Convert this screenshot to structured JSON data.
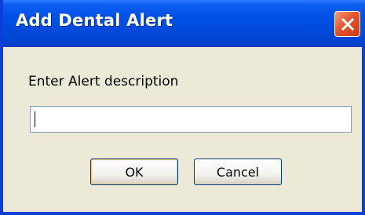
{
  "window": {
    "title": "Add Dental Alert",
    "close_icon": "close-x-icon"
  },
  "dialog": {
    "prompt": "Enter Alert description",
    "input_value": "",
    "input_placeholder": "",
    "ok_label": "OK",
    "cancel_label": "Cancel"
  },
  "colors": {
    "titlebar": "#0050e6",
    "window_background": "#ece9d8",
    "close_button": "#e4552c",
    "frame": "#0a3fd8"
  }
}
